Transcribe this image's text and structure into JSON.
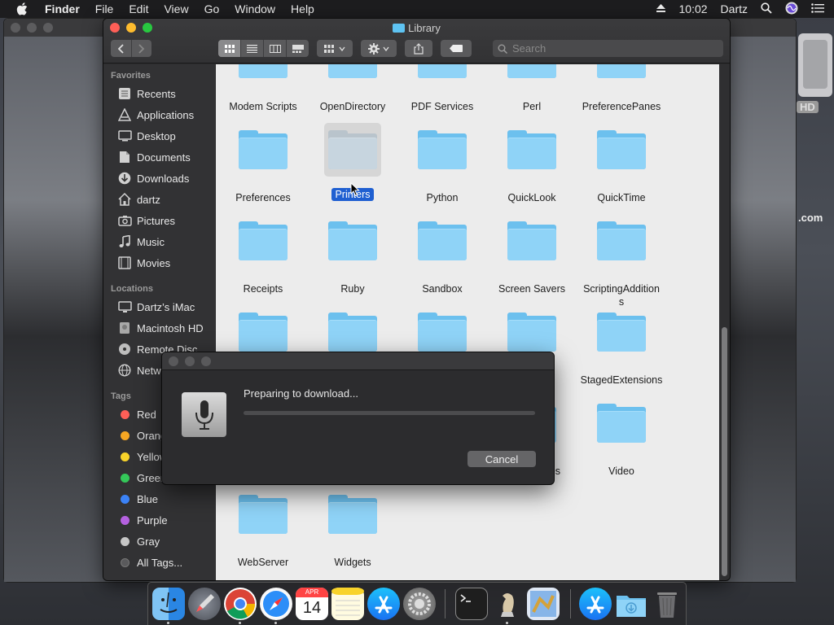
{
  "menubar": {
    "app": "Finder",
    "menus": [
      "File",
      "Edit",
      "View",
      "Go",
      "Window",
      "Help"
    ],
    "time": "10:02",
    "user": "Dartz"
  },
  "desktop": {
    "hd_label": "HD",
    "com_label": ".com"
  },
  "window": {
    "title": "Library",
    "search_placeholder": "Search"
  },
  "sidebar": {
    "favorites_header": "Favorites",
    "favorites": [
      "Recents",
      "Applications",
      "Desktop",
      "Documents",
      "Downloads",
      "dartz",
      "Pictures",
      "Music",
      "Movies"
    ],
    "locations_header": "Locations",
    "locations": [
      "Dartz’s iMac",
      "Macintosh HD",
      "Remote Disc",
      "Network"
    ],
    "tags_header": "Tags",
    "tags": [
      {
        "label": "Red",
        "color": "#fe5f57"
      },
      {
        "label": "Orange",
        "color": "#f5a623"
      },
      {
        "label": "Yellow",
        "color": "#f8d32a"
      },
      {
        "label": "Green",
        "color": "#34c759"
      },
      {
        "label": "Blue",
        "color": "#3b82f6"
      },
      {
        "label": "Purple",
        "color": "#b561e0"
      },
      {
        "label": "Gray",
        "color": "#c7c7c7"
      },
      {
        "label": "All Tags...",
        "color": "#5a5a5c"
      }
    ]
  },
  "folders": {
    "row1": [
      "Modem Scripts",
      "OpenDirectory",
      "PDF Services",
      "Perl",
      "PreferencePanes"
    ],
    "row2": [
      "Preferences",
      "Printers",
      "Python",
      "QuickLook",
      "QuickTime"
    ],
    "row3": [
      "Receipts",
      "Ruby",
      "Sandbox",
      "Screen Savers",
      "ScriptingAdditions"
    ],
    "row4": [
      "StagedExtensions"
    ],
    "row5_partial": "es",
    "row5": [
      "Video"
    ],
    "row6": [
      "WebServer",
      "Widgets"
    ],
    "selected": "Printers"
  },
  "dialog": {
    "message": "Preparing to download...",
    "cancel_label": "Cancel",
    "progress": 0
  },
  "dock": {
    "calendar_month": "APR",
    "calendar_day": "14"
  }
}
